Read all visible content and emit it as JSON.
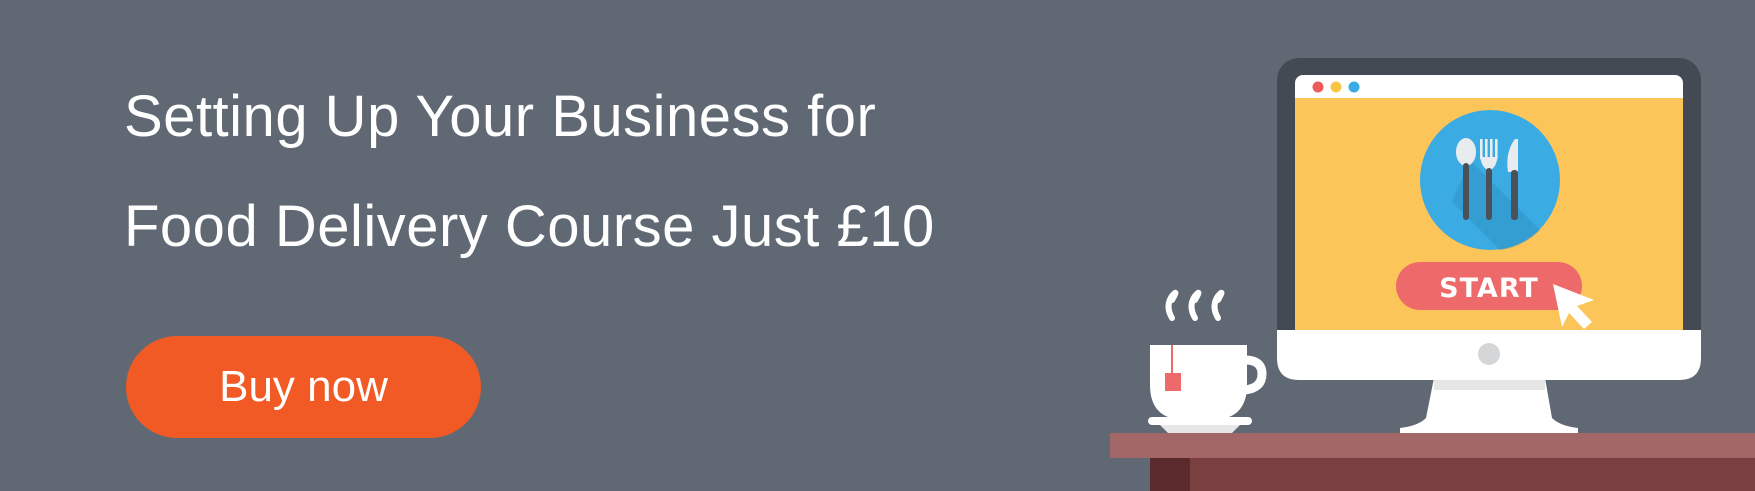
{
  "headline": {
    "line1": "Setting Up Your Business for",
    "line2": "Food Delivery Course Just £10"
  },
  "cta": {
    "label": "Buy now",
    "color": "#f15a24"
  },
  "screen": {
    "start_label": "START",
    "icons": [
      "spoon-icon",
      "fork-icon",
      "knife-icon",
      "cursor-arrow-icon"
    ]
  },
  "colors": {
    "background": "#5f6873",
    "monitor_bezel": "#434a54",
    "screen": "#fcc55a",
    "plate_circle": "#3aabe3",
    "start_button": "#ee6a6a",
    "desk": "#a26766"
  }
}
